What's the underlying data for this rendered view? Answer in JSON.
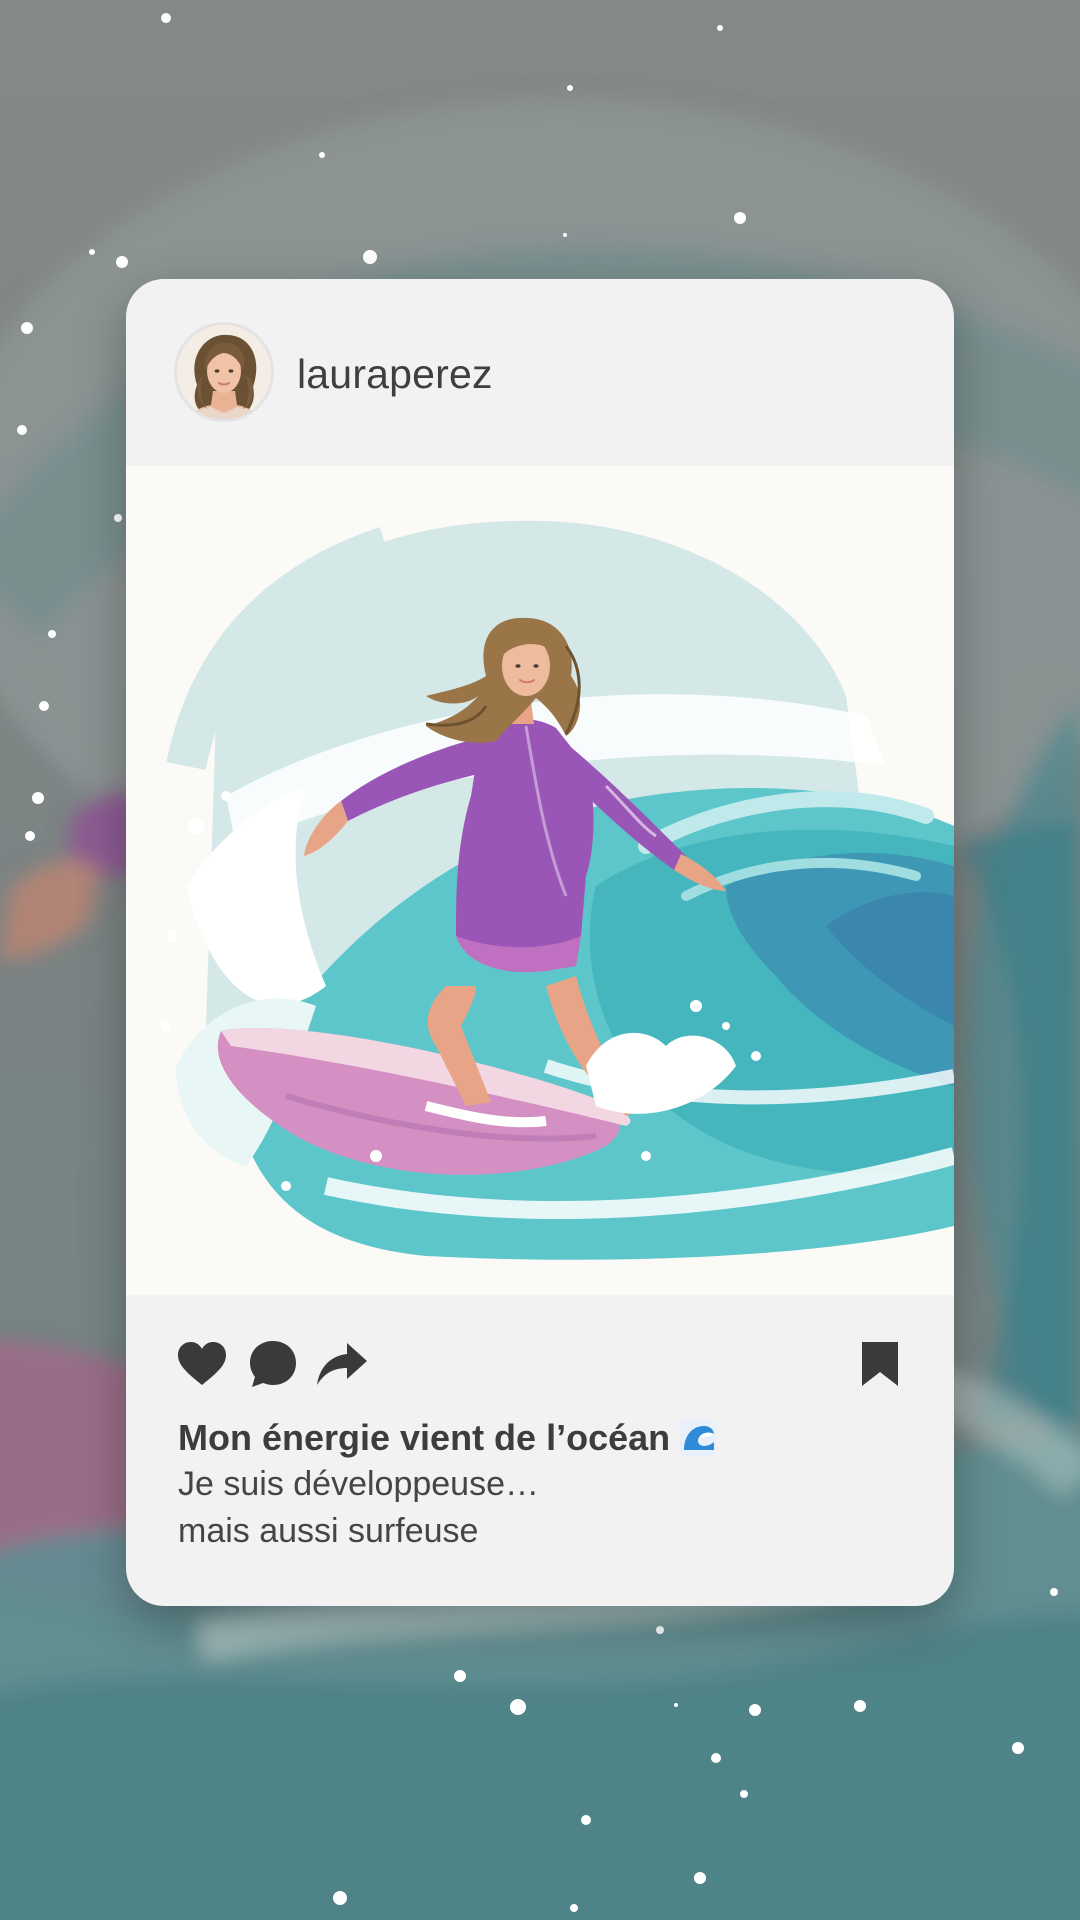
{
  "post": {
    "username": "lauraperez",
    "caption": {
      "title": "Mon énergie vient de l’océan",
      "title_emoji": "wave-icon",
      "line1": "Je suis développeuse…",
      "line2": "mais aussi surfeuse"
    },
    "actions": {
      "like_icon": "heart-icon",
      "comment_icon": "comment-bubble-icon",
      "share_icon": "share-arrow-icon",
      "save_icon": "bookmark-icon"
    }
  },
  "colors": {
    "card_background": "#f2f2f3",
    "icon_color": "#3a3a3a",
    "wetsuit": "#9b56b8",
    "wave_teal": "#4fc3c8",
    "wave_deep": "#3f8fb0",
    "surfboard": "#d88fc0",
    "page_background": "#7e8586"
  }
}
